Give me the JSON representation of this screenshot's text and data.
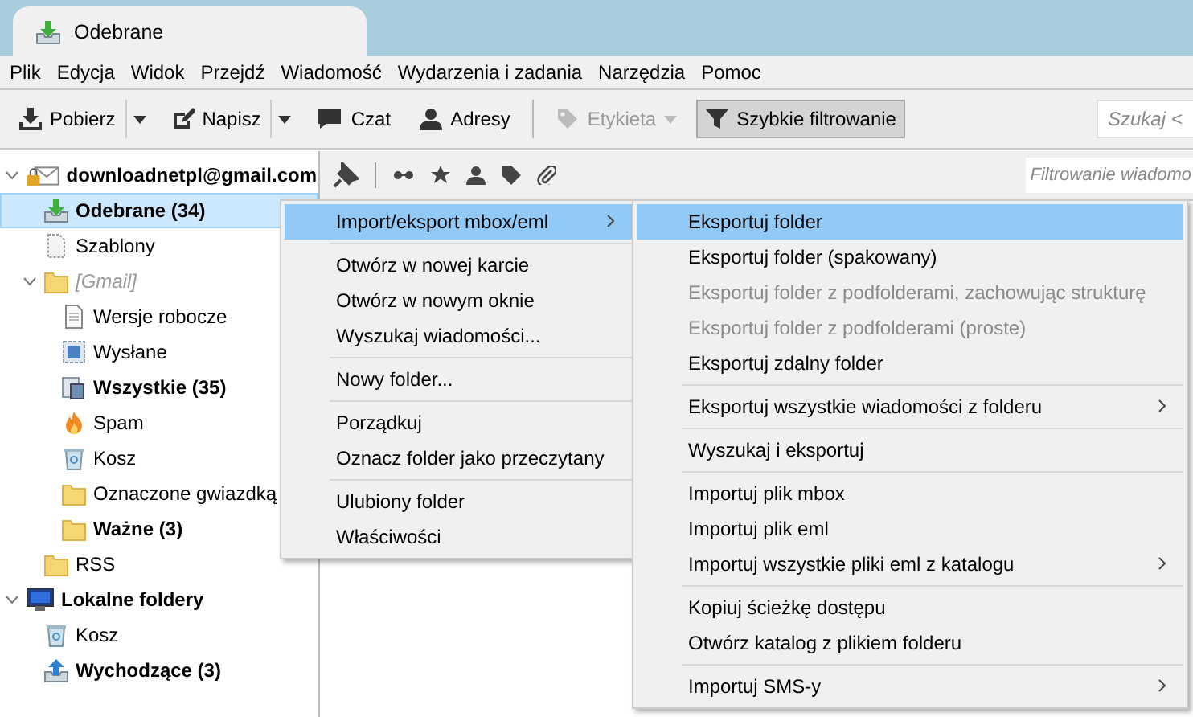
{
  "tab": {
    "title": "Odebrane"
  },
  "menubar": [
    "Plik",
    "Edycja",
    "Widok",
    "Przejdź",
    "Wiadomość",
    "Wydarzenia i zadania",
    "Narzędzia",
    "Pomoc"
  ],
  "toolbar": {
    "buttons": [
      {
        "kind": "download",
        "label": "Pobierz",
        "split_menu": true,
        "disabled": false,
        "on": false
      },
      {
        "kind": "compose",
        "label": "Napisz",
        "split_menu": true,
        "disabled": false,
        "on": false
      },
      {
        "kind": "chat",
        "label": "Czat",
        "disabled": false,
        "on": false
      },
      {
        "kind": "contacts",
        "label": "Adresy",
        "disabled": false,
        "on": false
      },
      {
        "kind": "separator"
      },
      {
        "kind": "tag",
        "label": "Etykieta",
        "inline_menu": true,
        "disabled": true,
        "on": false
      },
      {
        "kind": "filter",
        "label": "Szybkie filtrowanie",
        "disabled": false,
        "on": true
      }
    ],
    "search": {
      "placeholder": "Szukaj <"
    }
  },
  "folders": [
    {
      "kind": "account",
      "label": "downloadnetpl@gmail.com",
      "unread": true,
      "selected": false,
      "expanded": true,
      "children": [
        {
          "kind": "inbox",
          "label": "Odebrane (34)",
          "unread": true,
          "selected": true
        },
        {
          "kind": "templates",
          "label": "Szablony",
          "unread": false,
          "selected": false
        },
        {
          "kind": "virtual",
          "label": "[Gmail]",
          "unread": false,
          "selected": false,
          "expanded": true,
          "children": [
            {
              "kind": "drafts",
              "label": "Wersje robocze",
              "unread": false,
              "selected": false
            },
            {
              "kind": "sent",
              "label": "Wysłane",
              "unread": false,
              "selected": false
            },
            {
              "kind": "archive",
              "label": "Wszystkie (35)",
              "unread": true,
              "selected": false
            },
            {
              "kind": "spam",
              "label": "Spam",
              "unread": false,
              "selected": false
            },
            {
              "kind": "trash",
              "label": "Kosz",
              "unread": false,
              "selected": false
            },
            {
              "kind": "folder",
              "label": "Oznaczone gwiazdką",
              "unread": false,
              "selected": false
            },
            {
              "kind": "folder",
              "label": "Ważne (3)",
              "unread": true,
              "selected": false
            }
          ]
        },
        {
          "kind": "folder",
          "label": "RSS",
          "unread": false,
          "selected": false
        }
      ]
    },
    {
      "kind": "local",
      "label": "Lokalne foldery",
      "unread": true,
      "selected": false,
      "expanded": true,
      "children": [
        {
          "kind": "trash",
          "label": "Kosz",
          "unread": false,
          "selected": false
        },
        {
          "kind": "outbox",
          "label": "Wychodzące (3)",
          "unread": true,
          "selected": false
        }
      ]
    }
  ],
  "filter_bar": {
    "placeholder": "Filtrowanie wiadomo"
  },
  "context_menu": {
    "groups": [
      [
        {
          "label": "Import/eksport mbox/eml",
          "submenu": true,
          "selected": true,
          "disabled": false
        }
      ],
      [
        {
          "label": "Otwórz w nowej karcie",
          "submenu": false,
          "selected": false,
          "disabled": false
        },
        {
          "label": "Otwórz w nowym oknie",
          "submenu": false,
          "selected": false,
          "disabled": false
        },
        {
          "label": "Wyszukaj wiadomości...",
          "submenu": false,
          "selected": false,
          "disabled": false
        }
      ],
      [
        {
          "label": "Nowy folder...",
          "submenu": false,
          "selected": false,
          "disabled": false
        }
      ],
      [
        {
          "label": "Porządkuj",
          "submenu": false,
          "selected": false,
          "disabled": false
        },
        {
          "label": "Oznacz folder jako przeczytany",
          "submenu": false,
          "selected": false,
          "disabled": false
        }
      ],
      [
        {
          "label": "Ulubiony folder",
          "submenu": false,
          "selected": false,
          "disabled": false
        },
        {
          "label": "Właściwości",
          "submenu": false,
          "selected": false,
          "disabled": false
        }
      ]
    ]
  },
  "submenu": {
    "groups": [
      [
        {
          "label": "Eksportuj folder",
          "submenu": false,
          "selected": true,
          "disabled": false
        },
        {
          "label": "Eksportuj folder (spakowany)",
          "submenu": false,
          "selected": false,
          "disabled": false
        },
        {
          "label": "Eksportuj folder z podfolderami, zachowując strukturę",
          "submenu": false,
          "selected": false,
          "disabled": true
        },
        {
          "label": "Eksportuj folder z podfolderami (proste)",
          "submenu": false,
          "selected": false,
          "disabled": true
        },
        {
          "label": "Eksportuj zdalny folder",
          "submenu": false,
          "selected": false,
          "disabled": false
        }
      ],
      [
        {
          "label": "Eksportuj wszystkie wiadomości z folderu",
          "submenu": true,
          "selected": false,
          "disabled": false
        }
      ],
      [
        {
          "label": "Wyszukaj i eksportuj",
          "submenu": false,
          "selected": false,
          "disabled": false
        }
      ],
      [
        {
          "label": "Importuj plik mbox",
          "submenu": false,
          "selected": false,
          "disabled": false
        },
        {
          "label": "Importuj plik eml",
          "submenu": false,
          "selected": false,
          "disabled": false
        },
        {
          "label": "Importuj wszystkie pliki eml z katalogu",
          "submenu": true,
          "selected": false,
          "disabled": false
        }
      ],
      [
        {
          "label": "Kopiuj ścieżkę dostępu",
          "submenu": false,
          "selected": false,
          "disabled": false
        },
        {
          "label": "Otwórz katalog z plikiem folderu",
          "submenu": false,
          "selected": false,
          "disabled": false
        }
      ],
      [
        {
          "label": "Importuj SMS-y",
          "submenu": true,
          "selected": false,
          "disabled": false
        }
      ]
    ]
  }
}
